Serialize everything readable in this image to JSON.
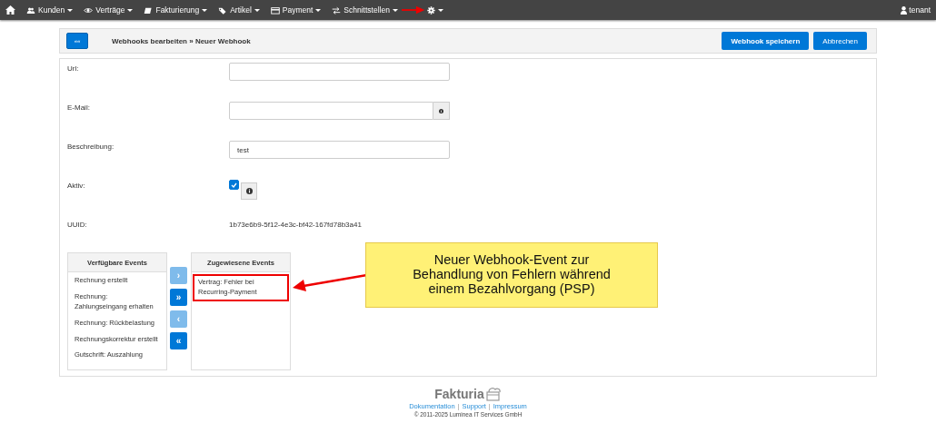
{
  "navbar": {
    "items": [
      {
        "label": "Kunden"
      },
      {
        "label": "Verträge"
      },
      {
        "label": "Fakturierung"
      },
      {
        "label": "Artikel"
      },
      {
        "label": "Payment"
      },
      {
        "label": "Schnittstellen"
      }
    ],
    "user": "tenant"
  },
  "header": {
    "back_button": "««",
    "title": "Webhooks bearbeiten » Neuer Webhook",
    "buttons": [
      {
        "label": "Webhook speichern",
        "primary": true
      },
      {
        "label": "Abbrechen",
        "primary": false
      }
    ]
  },
  "form": {
    "fields": [
      {
        "kind": "text",
        "label": "Url:"
      },
      {
        "kind": "text-info",
        "label": "E-Mail:"
      },
      {
        "kind": "text",
        "label": "Beschreibung:",
        "value": "test"
      },
      {
        "kind": "checkbox",
        "label": "Aktiv:",
        "checked": true
      },
      {
        "kind": "readonly",
        "label": "UUID:",
        "value": "1b73e6b9-5f12-4e3c-bf42-167fd78b3a41"
      }
    ]
  },
  "events": {
    "available": {
      "title": "Verfügbare Events",
      "items": [
        "Rechnung erstellt",
        "Rechnung: Zahlungseingang erhalten",
        "Rechnung: Rückbelastung",
        "Rechnungskorrektur erstellt",
        "Gutschrift: Auszahlung"
      ]
    },
    "move_buttons": [
      {
        "label": "›",
        "disabled": true
      },
      {
        "label": "»",
        "disabled": false
      },
      {
        "label": "‹",
        "disabled": true
      },
      {
        "label": "«",
        "disabled": false
      }
    ],
    "assigned": {
      "title": "Zugewiesene Events",
      "items": [
        {
          "label": "Vertrag: Fehler bei Recurring-Payment",
          "highlighted": true
        }
      ]
    }
  },
  "callout": "Neuer Webhook-Event zur Behandlung von Fehlern während einem Bezahlvorgang (PSP)",
  "footer": {
    "logo": "Fakturia",
    "links": [
      "Dokumentation",
      "Support",
      "Impressum"
    ],
    "separator": "|",
    "copyright": "© 2011-2025 Luminea IT Services GmbH"
  }
}
